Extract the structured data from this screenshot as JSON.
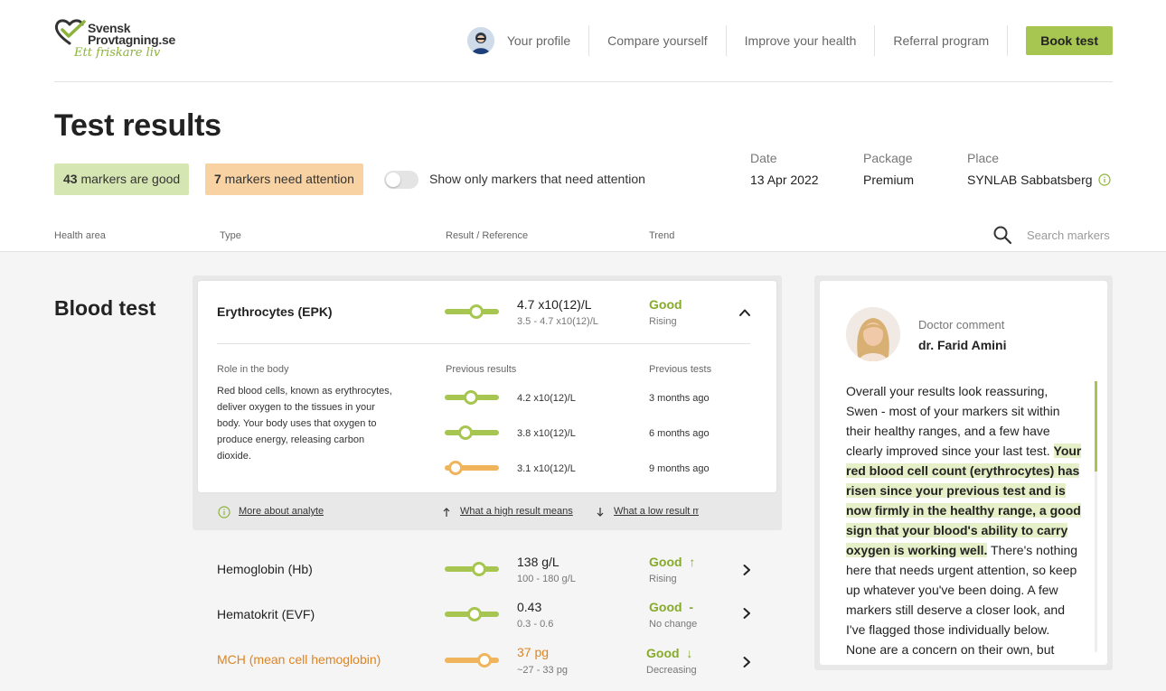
{
  "brand": {
    "name_line1": "Svensk",
    "name_line2": "Provtagning.se",
    "tagline": "Ett friskare liv"
  },
  "nav": {
    "items": [
      "Your profile",
      "Compare yourself",
      "Improve your health",
      "Referral program"
    ],
    "cta": "Book test"
  },
  "page": {
    "title": "Test results"
  },
  "summary": {
    "good_count": "43",
    "good_text": " markers are good",
    "attn_count": "7",
    "attn_text": " markers need attention",
    "toggle_label": "Show only markers that need attention",
    "toggle_on": false
  },
  "meta": {
    "date_label": "Date",
    "date_value": "13 Apr 2022",
    "package_label": "Package",
    "package_value": "Premium",
    "place_label": "Place",
    "place_value": "SYNLAB Sabbatsberg"
  },
  "columns": {
    "health_area": "Health area",
    "type": "Type",
    "result": "Result / Reference",
    "trend": "Trend"
  },
  "search": {
    "placeholder": "Search markers"
  },
  "section": {
    "title": "Blood test"
  },
  "expanded": {
    "name": "Erythrocytes (EPK)",
    "value": "4.7 x10(12)/L",
    "reference": "3.5 - 4.7 x10(12)/L",
    "status": "Good",
    "trend": "Rising",
    "gauge_level": 0.58,
    "role_label": "Role in the body",
    "role_text": "Red blood cells, known as erythrocytes, deliver oxygen to the tissues in your body. Your body uses that oxygen to produce energy, releasing carbon dioxide.",
    "prev_results_label": "Previous results",
    "prev_tests_label": "Previous tests",
    "previous": [
      {
        "value": "4.2 x10(12)/L",
        "when": "3 months ago",
        "level": 0.48,
        "color": "green"
      },
      {
        "value": "3.8 x10(12)/L",
        "when": "6 months ago",
        "level": 0.38,
        "color": "green"
      },
      {
        "value": "3.1 x10(12)/L",
        "when": "9 months ago",
        "level": 0.2,
        "color": "orange"
      }
    ],
    "link_more": "More about analyte",
    "link_high": "What a high result means",
    "link_low": "What a low result means"
  },
  "markers": [
    {
      "name": "Hemoglobin (Hb)",
      "value": "138 g/L",
      "reference": "100 - 180 g/L",
      "status": "Good",
      "trend_symbol": "↑",
      "trend": "Rising",
      "level": 0.63,
      "color": "green",
      "warn": false
    },
    {
      "name": "Hematokrit (EVF)",
      "value": "0.43",
      "reference": "0.3 - 0.6",
      "status": "Good",
      "trend_symbol": "-",
      "trend": "No change",
      "level": 0.55,
      "color": "green",
      "warn": false
    },
    {
      "name": "MCH (mean cell hemoglobin)",
      "value": "37 pg",
      "reference": "~27 - 33 pg",
      "status": "Good",
      "trend_symbol": "↓",
      "trend": "Decreasing",
      "level": 0.73,
      "color": "orange",
      "warn": true
    }
  ],
  "doctor": {
    "label": "Doctor comment",
    "name": "dr. Farid Amini",
    "text_before": "Overall your results look reassuring, Swen - most of your markers sit within their healthy ranges, and a few have clearly improved since your last test. ",
    "text_highlight": "Your red blood cell count (erythrocytes) has risen since your previous test and is now firmly in the healthy range, a good sign that your blood's ability to carry oxygen is working well.",
    "text_after": " There's nothing here that needs urgent attention, so keep up whatever you've been doing. A few markers still deserve a closer look, and I've flagged those individually below. None are a concern on their own, but"
  },
  "colors": {
    "accent_green": "#a7c551",
    "status_green": "#86ab2a",
    "warn_orange": "#e08421",
    "gauge_orange": "#f0b55c",
    "good_pill": "#d6e6b3",
    "attn_pill": "#f8d2a2"
  }
}
